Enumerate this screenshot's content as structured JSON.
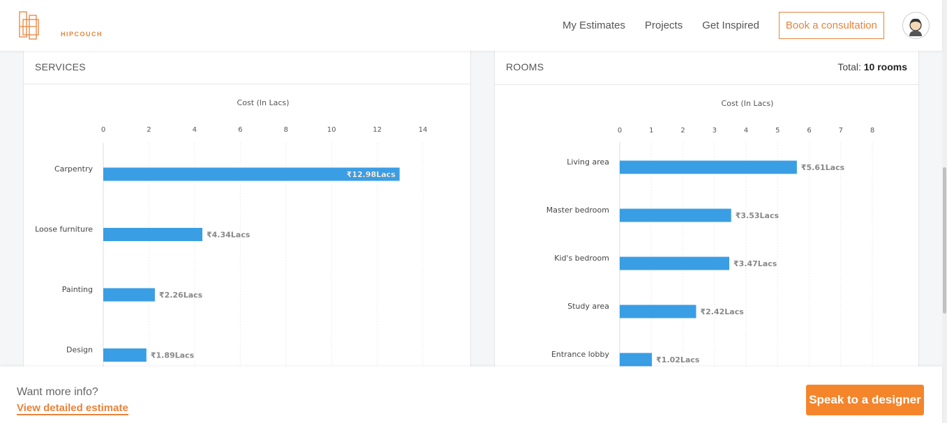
{
  "header": {
    "logo_text": "HIPCOUCH",
    "nav": [
      "My Estimates",
      "Projects",
      "Get Inspired"
    ],
    "consult_label": "Book a consultation"
  },
  "services": {
    "title": "SERVICES"
  },
  "rooms": {
    "title": "ROOMS",
    "total_label": "Total:",
    "total_value": "10 rooms"
  },
  "bottom": {
    "more_info": "Want more info?",
    "view_link": "View detailed estimate",
    "speak_label": "Speak to a designer"
  },
  "colors": {
    "accent": "#e8833a",
    "bar": "#3a9ee4",
    "cta": "#f5852b"
  },
  "chart_data": [
    {
      "type": "bar",
      "orientation": "horizontal",
      "xlabel": "Cost (In Lacs)",
      "xlim": [
        0,
        14
      ],
      "ticks": [
        0,
        2,
        4,
        6,
        8,
        10,
        12,
        14
      ],
      "categories": [
        "Carpentry",
        "Loose furniture",
        "Painting",
        "Design"
      ],
      "values": [
        12.98,
        4.34,
        2.26,
        1.89
      ],
      "labels": [
        "₹12.98Lacs",
        "₹4.34Lacs",
        "₹2.26Lacs",
        "₹1.89Lacs"
      ]
    },
    {
      "type": "bar",
      "orientation": "horizontal",
      "xlabel": "Cost (In Lacs)",
      "xlim": [
        0,
        8
      ],
      "ticks": [
        0,
        1,
        2,
        3,
        4,
        5,
        6,
        7,
        8
      ],
      "categories": [
        "Living area",
        "Master bedroom",
        "Kid's bedroom",
        "Study area",
        "Entrance lobby"
      ],
      "values": [
        5.61,
        3.53,
        3.47,
        2.42,
        1.02
      ],
      "labels": [
        "₹5.61Lacs",
        "₹3.53Lacs",
        "₹3.47Lacs",
        "₹2.42Lacs",
        "₹1.02Lacs"
      ]
    }
  ]
}
